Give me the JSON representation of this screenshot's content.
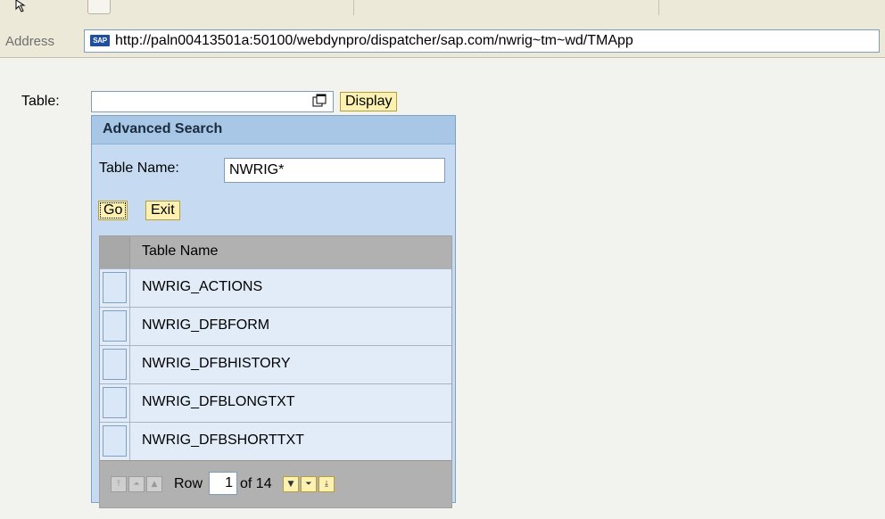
{
  "browser": {
    "address_label": "Address",
    "url": "http://paln00413501a:50100/webdynpro/dispatcher/sap.com/nwrig~tm~wd/TMApp",
    "site_icon": "sap-logo-icon",
    "site_icon_text": "SAP"
  },
  "form": {
    "table_label": "Table:",
    "table_value": "",
    "value_help_icon": "value-help-icon",
    "display_label": "Display"
  },
  "popup": {
    "title": "Advanced Search",
    "name_label": "Table Name:",
    "name_value": "NWRIG*",
    "go_label": "Go",
    "exit_label": "Exit",
    "table": {
      "column_header": "Table Name",
      "rows": [
        "NWRIG_ACTIONS",
        "NWRIG_DFBFORM",
        "NWRIG_DFBHISTORY",
        "NWRIG_DFBLONGTXT",
        "NWRIG_DFBSHORTTXT"
      ]
    },
    "pager": {
      "row_label": "Row",
      "current_row": "1",
      "of_label": "of 14",
      "icons": [
        "first-page-icon",
        "previous-page-icon",
        "previous-row-icon",
        "next-row-icon",
        "next-page-icon",
        "last-page-icon"
      ]
    }
  },
  "colors": {
    "button_bg": "#fdf1b1",
    "popup_bg": "#c6dbf1",
    "popup_header_bg": "#a8c6e5",
    "table_header_bg": "#b1b1b1"
  }
}
